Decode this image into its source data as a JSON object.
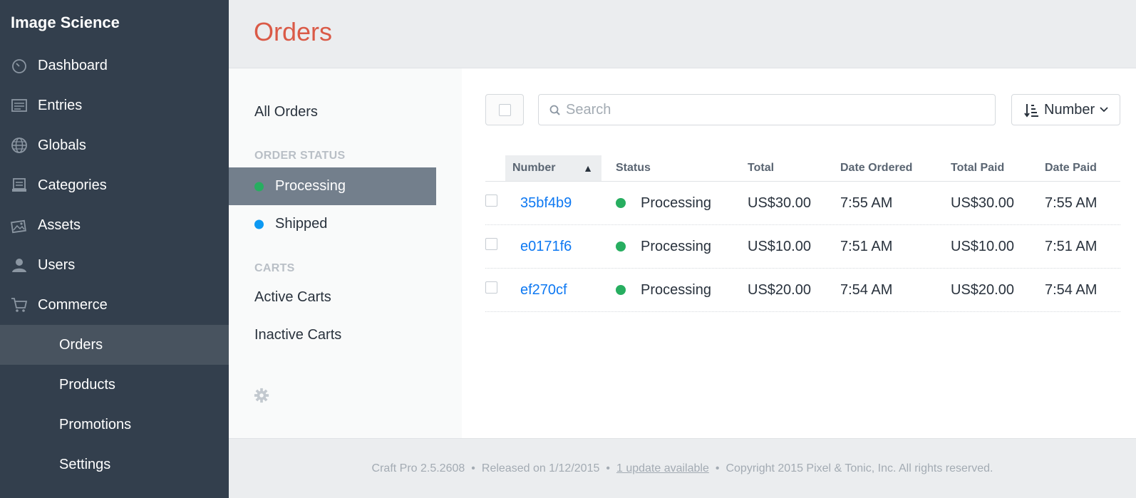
{
  "site_name": "Image Science",
  "nav": {
    "items": [
      {
        "label": "Dashboard",
        "icon": "dashboard-icon"
      },
      {
        "label": "Entries",
        "icon": "entries-icon"
      },
      {
        "label": "Globals",
        "icon": "globe-icon"
      },
      {
        "label": "Categories",
        "icon": "categories-icon"
      },
      {
        "label": "Assets",
        "icon": "assets-icon"
      },
      {
        "label": "Users",
        "icon": "users-icon"
      },
      {
        "label": "Commerce",
        "icon": "cart-icon"
      }
    ],
    "sub_items": [
      {
        "label": "Orders",
        "active": true
      },
      {
        "label": "Products"
      },
      {
        "label": "Promotions"
      },
      {
        "label": "Settings"
      }
    ]
  },
  "header": {
    "title": "Orders"
  },
  "subnav": {
    "all_orders": "All Orders",
    "order_status_heading": "ORDER STATUS",
    "statuses": [
      {
        "label": "Processing",
        "color": "#27ae60",
        "active": true
      },
      {
        "label": "Shipped",
        "color": "#0d99f2"
      }
    ],
    "carts_heading": "CARTS",
    "carts": [
      "Active Carts",
      "Inactive Carts"
    ],
    "settings_icon": "gear-icon"
  },
  "toolbar": {
    "search_placeholder": "Search",
    "sort_label": "Number",
    "sort_icon": "sort-icon"
  },
  "table": {
    "columns": [
      "Number",
      "Status",
      "Total",
      "Date Ordered",
      "Total Paid",
      "Date Paid"
    ],
    "sort_indicator": "▲",
    "rows": [
      {
        "number": "35bf4b9",
        "status": "Processing",
        "status_color": "#27ae60",
        "total": "US$30.00",
        "date_ordered": "7:55 AM",
        "total_paid": "US$30.00",
        "date_paid": "7:55 AM"
      },
      {
        "number": "e0171f6",
        "status": "Processing",
        "status_color": "#27ae60",
        "total": "US$10.00",
        "date_ordered": "7:51 AM",
        "total_paid": "US$10.00",
        "date_paid": "7:51 AM"
      },
      {
        "number": "ef270cf",
        "status": "Processing",
        "status_color": "#27ae60",
        "total": "US$20.00",
        "date_ordered": "7:54 AM",
        "total_paid": "US$20.00",
        "date_paid": "7:54 AM"
      }
    ]
  },
  "footer": {
    "version": "Craft Pro 2.5.2608",
    "released": "Released on 1/12/2015",
    "update": "1 update available",
    "copyright": "Copyright 2015 Pixel & Tonic, Inc. All rights reserved.",
    "separator": "•"
  },
  "colors": {
    "sidebar_bg": "#333f4d",
    "title": "#da5a47",
    "link": "#0d78f2",
    "active_subnav": "#737f8c"
  }
}
